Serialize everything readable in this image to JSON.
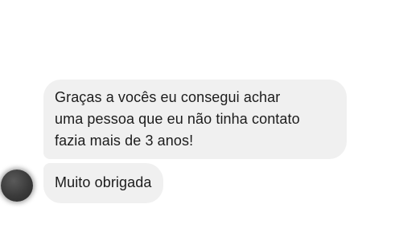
{
  "conversation": {
    "messages": [
      {
        "lines": [
          "Graças a vocês eu consegui achar",
          "uma pessoa que eu não tinha contato",
          "fazia mais de 3 anos!"
        ]
      },
      {
        "text": "Muito obrigada"
      }
    ],
    "bubble_color": "#f0f0f0",
    "text_color": "#1c1c1c",
    "background_color": "#ffffff"
  }
}
